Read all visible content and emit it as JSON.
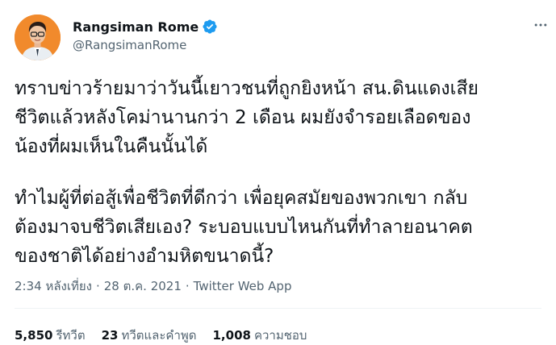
{
  "user": {
    "display_name": "Rangsiman Rome",
    "handle": "@RangsimanRome",
    "verified": true,
    "avatar_bg_color": "#f18a2c"
  },
  "icons": {
    "verified": "verified-badge-icon",
    "more": "more-options-icon"
  },
  "tweet": {
    "paragraphs": [
      "ทราบข่าวร้ายมาว่าวันนี้เยาวชนที่ถูกยิงหน้า สน.ดินแดงเสีย\nชีวิตแล้วหลังโคม่านานกว่า 2 เดือน ผมยังจำรอยเลือดของ\nน้องที่ผมเห็นในคืนนั้นได้",
      "ทำไมผู้ที่ต่อสู้เพื่อชีวิตที่ดีกว่า เพื่อยุคสมัยของพวกเขา กลับ\nต้องมาจบชีวิตเสียเอง? ระบอบแบบไหนกันที่ทำลายอนาคต\nของชาติได้อย่างอำมหิตขนาดนี้?"
    ]
  },
  "meta": {
    "time": "2:34 หลังเที่ยง",
    "separator": "·",
    "date": "28 ต.ค. 2021",
    "app": "Twitter Web App"
  },
  "stats": {
    "retweets": {
      "count": "5,850",
      "label": "รีทวีต"
    },
    "quotes": {
      "count": "23",
      "label": "ทวีตและคำพูด"
    },
    "likes": {
      "count": "1,008",
      "label": "ความชอบ"
    }
  },
  "colors": {
    "text": "#0f1419",
    "secondary": "#536471",
    "verified": "#1d9bf0",
    "divider": "#eff3f4"
  }
}
